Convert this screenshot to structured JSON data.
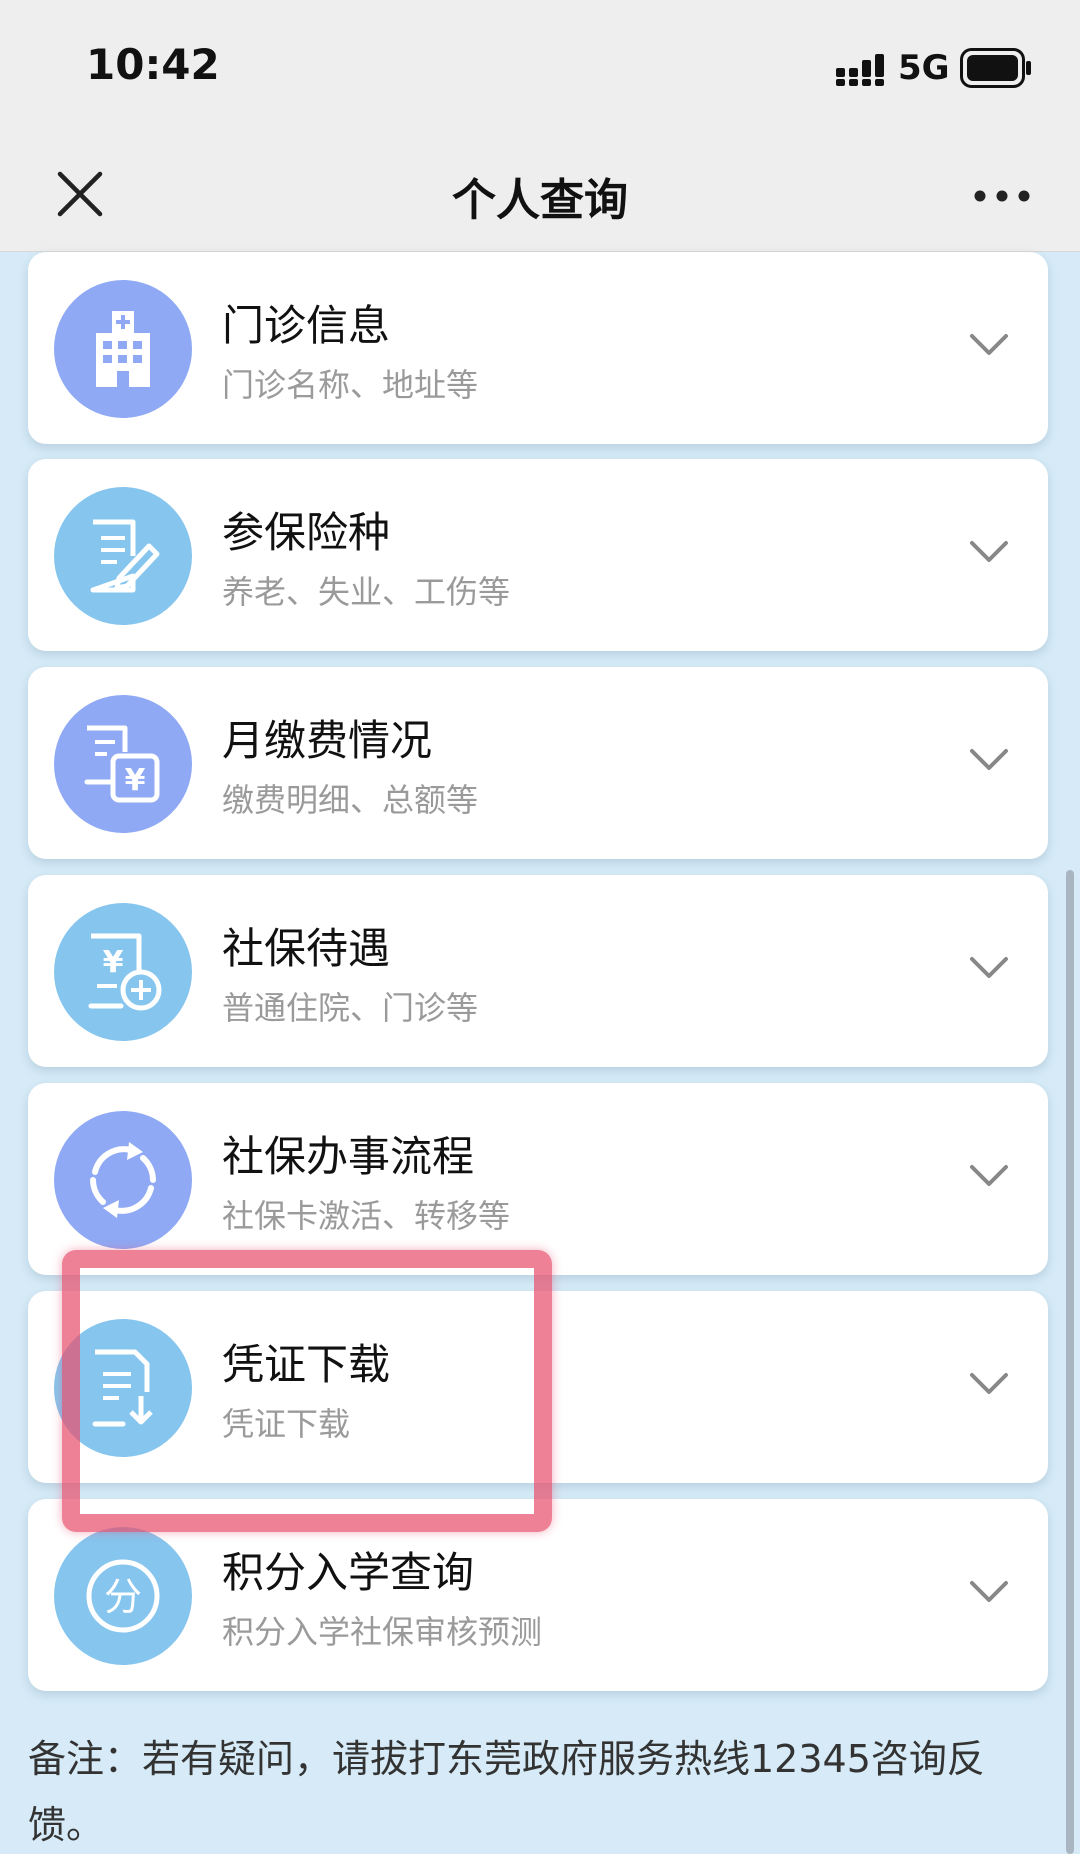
{
  "status_bar": {
    "time": "10:42",
    "network": "5G"
  },
  "nav": {
    "title": "个人查询",
    "close_icon": "close-icon",
    "more_icon": "more-horizontal-icon"
  },
  "items": [
    {
      "title": "门诊信息",
      "subtitle": "门诊名称、地址等",
      "icon": "hospital-icon",
      "color": "#8fa9f4"
    },
    {
      "title": "参保险种",
      "subtitle": "养老、失业、工伤等",
      "icon": "document-edit-icon",
      "color": "#86c5ee"
    },
    {
      "title": "月缴费情况",
      "subtitle": "缴费明细、总额等",
      "icon": "payment-bill-icon",
      "color": "#8fa9f4"
    },
    {
      "title": "社保待遇",
      "subtitle": "普通住院、门诊等",
      "icon": "benefit-bill-icon",
      "color": "#86c5ee"
    },
    {
      "title": "社保办事流程",
      "subtitle": "社保卡激活、转移等",
      "icon": "refresh-cycle-icon",
      "color": "#8fa9f4"
    },
    {
      "title": "凭证下载",
      "subtitle": "凭证下载",
      "icon": "voucher-download-icon",
      "color": "#86c5ee"
    },
    {
      "title": "积分入学查询",
      "subtitle": "积分入学社保审核预测",
      "icon": "points-icon",
      "color": "#86c5ee"
    }
  ],
  "note": "备注：若有疑问，请拔打东莞政府服务热线12345咨询反馈。",
  "colors": {
    "background": "#d6ebf7",
    "highlight": "#e8506e"
  }
}
